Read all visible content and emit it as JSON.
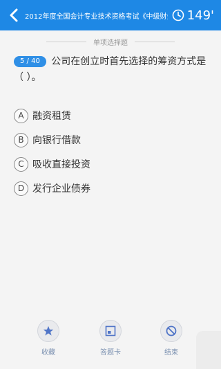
{
  "header": {
    "title": "2012年度全国会计专业技术资格考试《中级财务管...",
    "timer": "149'"
  },
  "section_label": "单项选择题",
  "question": {
    "index": "5 / 40",
    "text": "公司在创立时首先选择的筹资方式是（ ）。"
  },
  "options": [
    {
      "letter": "A",
      "text": "融资租赁"
    },
    {
      "letter": "B",
      "text": "向银行借款"
    },
    {
      "letter": "C",
      "text": "吸收直接投资"
    },
    {
      "letter": "D",
      "text": "发行企业债券"
    }
  ],
  "toolbar": {
    "favorite": "收藏",
    "answer_card": "答题卡",
    "finish": "结束"
  },
  "colors": {
    "header": "#1e88e5",
    "badge": "#2f8fe6",
    "toolbar_icon": "#4f74c7"
  }
}
